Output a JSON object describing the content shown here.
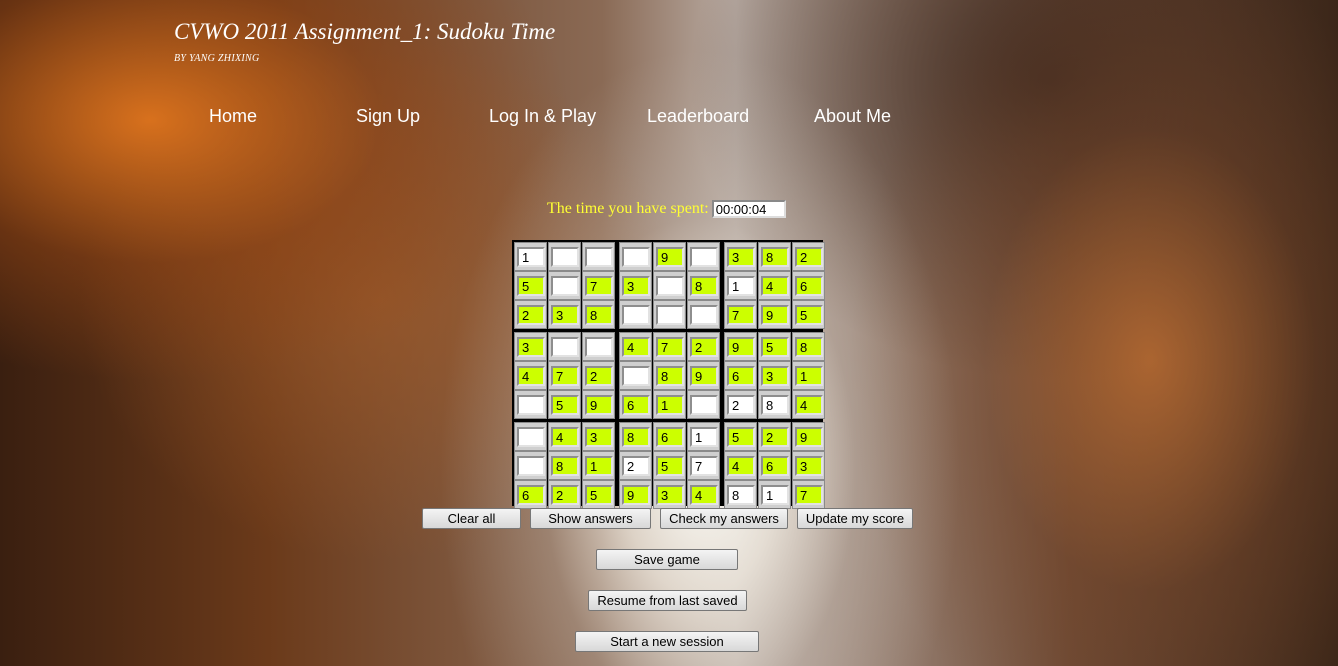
{
  "header": {
    "title": "CVWO 2011 Assignment_1: Sudoku Time",
    "byline": "BY YANG ZHIXING"
  },
  "nav": [
    "Home",
    "Sign Up",
    "Log In & Play",
    "Leaderboard",
    "About Me"
  ],
  "timer": {
    "label": "The time you have spent:",
    "value": "00:00:04"
  },
  "colors": {
    "given_cell": "#ccff00",
    "timer_label": "#ffff33"
  },
  "board": [
    [
      "1",
      "",
      "",
      "",
      "9",
      "",
      "3",
      "8",
      "2"
    ],
    [
      "5",
      "",
      "7",
      "3",
      "",
      "8",
      "1",
      "4",
      "6"
    ],
    [
      "2",
      "3",
      "8",
      "",
      "",
      "",
      "7",
      "9",
      "5"
    ],
    [
      "3",
      "",
      "",
      "4",
      "7",
      "2",
      "9",
      "5",
      "8"
    ],
    [
      "4",
      "7",
      "2",
      "",
      "8",
      "9",
      "6",
      "3",
      "1"
    ],
    [
      "",
      "5",
      "9",
      "6",
      "1",
      "",
      "2",
      "8",
      "4"
    ],
    [
      "",
      "4",
      "3",
      "8",
      "6",
      "1",
      "5",
      "2",
      "9"
    ],
    [
      "",
      "8",
      "1",
      "2",
      "5",
      "7",
      "4",
      "6",
      "3"
    ],
    [
      "6",
      "2",
      "5",
      "9",
      "3",
      "4",
      "8",
      "1",
      "7"
    ]
  ],
  "given": [
    [
      0,
      0,
      0,
      0,
      1,
      0,
      1,
      1,
      1
    ],
    [
      1,
      0,
      1,
      1,
      0,
      1,
      0,
      1,
      1
    ],
    [
      1,
      1,
      1,
      0,
      0,
      0,
      1,
      1,
      1
    ],
    [
      1,
      0,
      0,
      1,
      1,
      1,
      1,
      1,
      1
    ],
    [
      1,
      1,
      1,
      0,
      1,
      1,
      1,
      1,
      1
    ],
    [
      0,
      1,
      1,
      1,
      1,
      0,
      0,
      0,
      1
    ],
    [
      0,
      1,
      1,
      1,
      1,
      0,
      1,
      1,
      1
    ],
    [
      0,
      1,
      1,
      0,
      1,
      0,
      1,
      1,
      1
    ],
    [
      1,
      1,
      1,
      1,
      1,
      1,
      0,
      0,
      1
    ]
  ],
  "buttons": {
    "clear_all": "Clear all",
    "show_answers": "Show answers",
    "check_answers": "Check my answers",
    "update_score": "Update my score",
    "save_game": "Save game",
    "resume": "Resume from last saved",
    "new_session": "Start a new session"
  }
}
